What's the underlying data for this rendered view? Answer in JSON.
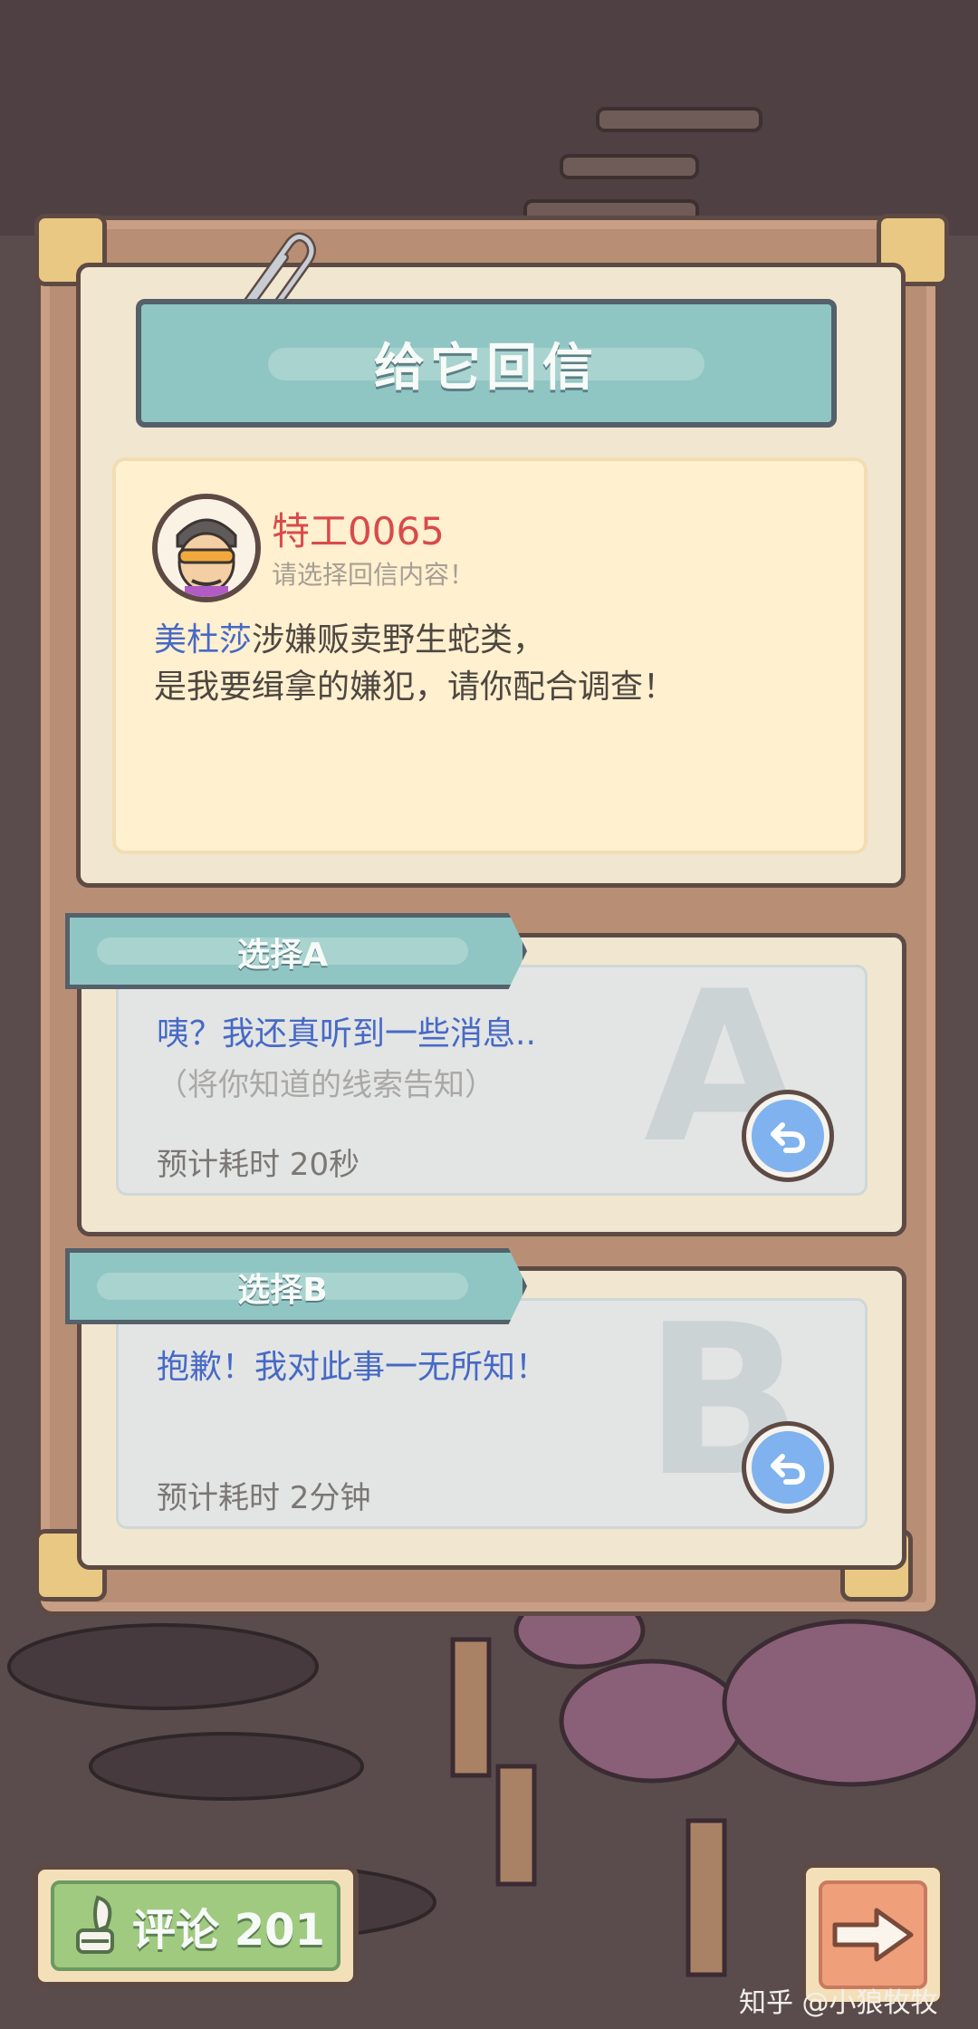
{
  "dialog": {
    "title": "给它回信",
    "message": {
      "sender": "特工0065",
      "prompt": "请选择回信内容！",
      "highlight": "美杜莎",
      "line1_rest": "涉嫌贩卖野生蛇类，",
      "line2": "是我要缉拿的嫌犯，请你配合调查！"
    },
    "choices": [
      {
        "tag": "选择A",
        "letter": "A",
        "text": "咦？我还真听到一些消息..",
        "note": "（将你知道的线索告知）",
        "eta": "预计耗时  20秒"
      },
      {
        "tag": "选择B",
        "letter": "B",
        "text": "抱歉！我对此事一无所知！",
        "note": "",
        "eta": "预计耗时  2分钟"
      }
    ]
  },
  "footer": {
    "comment_label": "评论 201",
    "watermark": "知乎 @小狼牧牧"
  },
  "colors": {
    "panel": "#b88f74",
    "banner": "#8fc6c4",
    "highlight_text": "#4769c6",
    "sender_text": "#d84b4b"
  }
}
